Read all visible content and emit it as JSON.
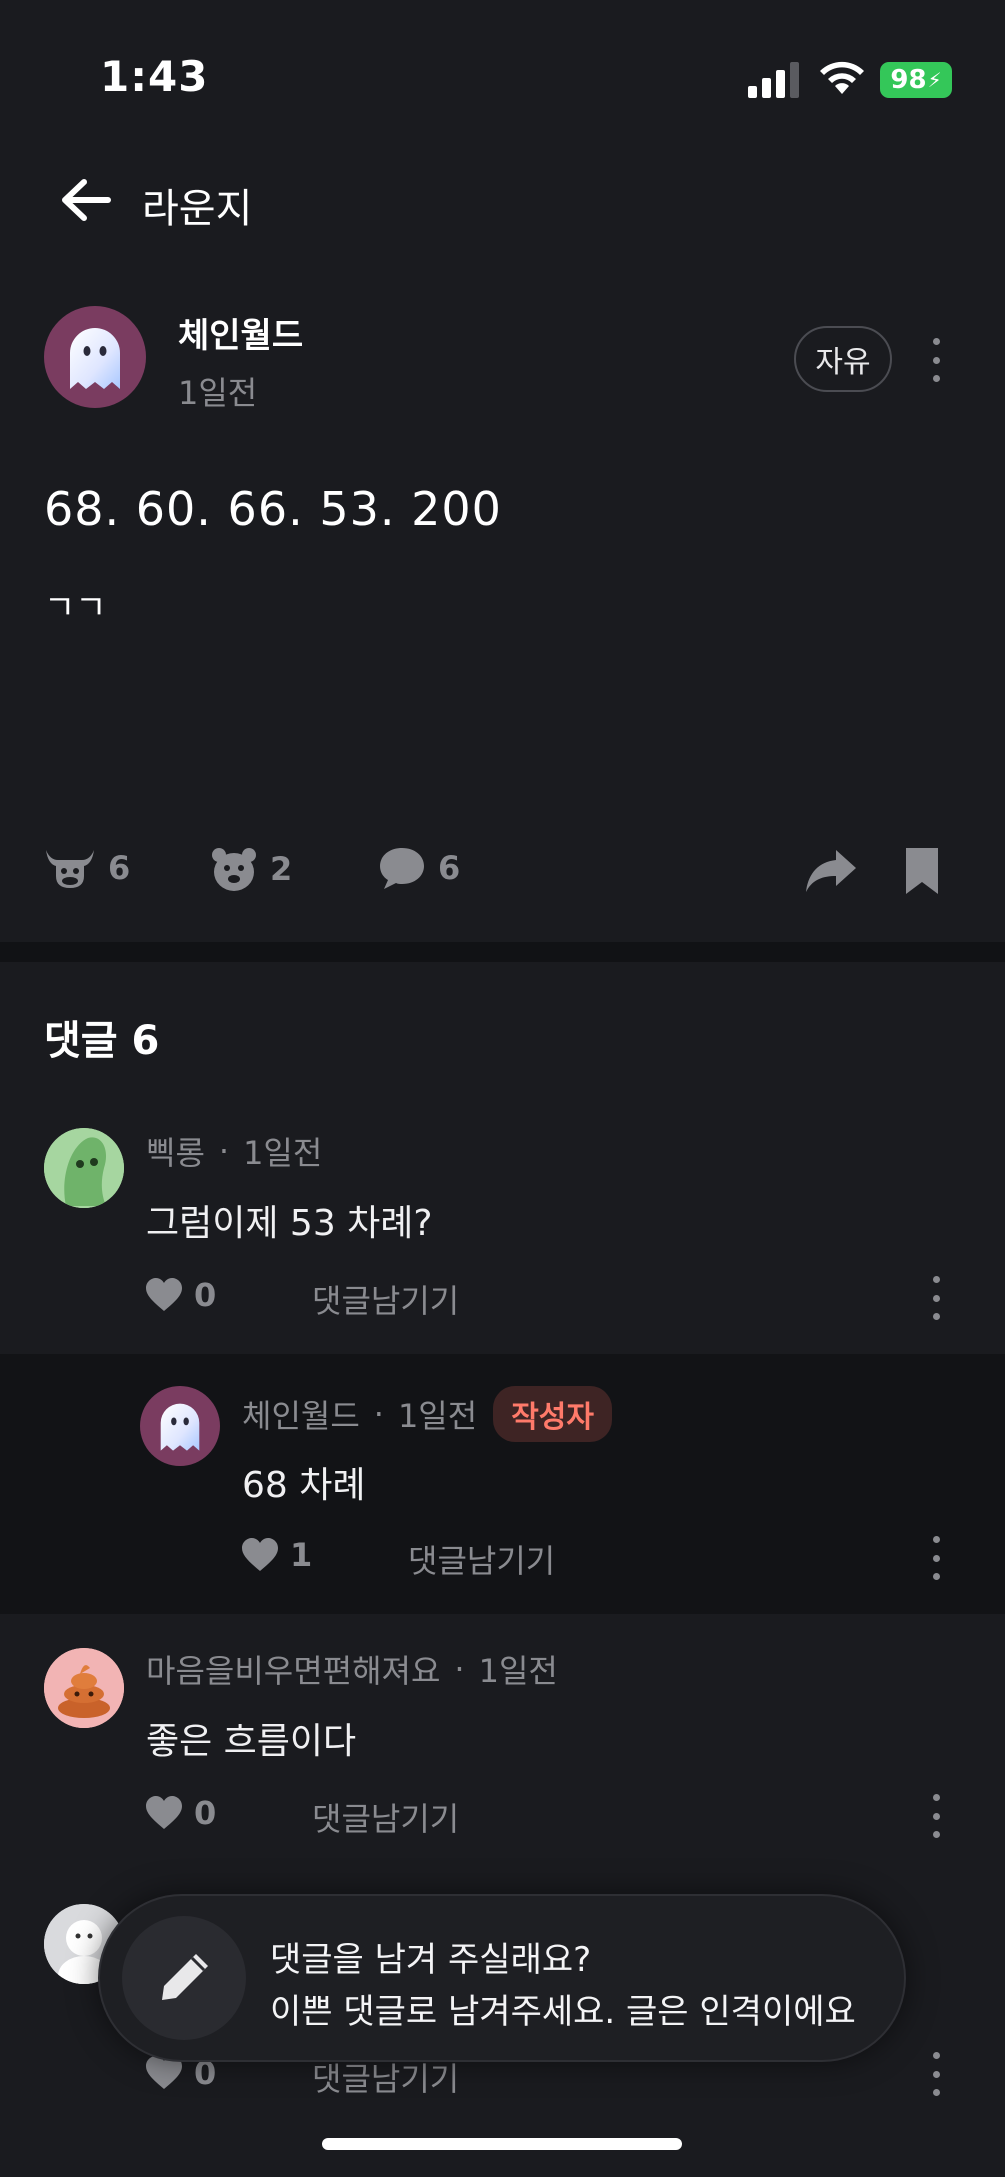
{
  "status_bar": {
    "time": "1:43",
    "battery": "98"
  },
  "header": {
    "title": "라운지"
  },
  "post": {
    "author": "체인월드",
    "time": "1일전",
    "tag": "자유",
    "title": "68. 60. 66. 53. 200",
    "body": "ㄱㄱ",
    "actions": {
      "bull_count": "6",
      "bear_count": "2",
      "comment_count": "6"
    }
  },
  "comments_section": {
    "title": "댓글 6"
  },
  "comments": [
    {
      "author": "삑롱",
      "time": "1일전",
      "text": "그럼이제 53 차례?",
      "likes": "0",
      "reply_label": "댓글남기기"
    },
    {
      "author": "체인월드",
      "time": "1일전",
      "badge": "작성자",
      "text": "68 차례",
      "likes": "1",
      "reply_label": "댓글남기기"
    },
    {
      "author": "마음을비우면편해져요",
      "time": "1일전",
      "text": "좋은 흐름이다",
      "likes": "0",
      "reply_label": "댓글남기기"
    },
    {
      "likes": "0",
      "reply_label": "댓글남기기"
    }
  ],
  "composer": {
    "line1": "댓글을 남겨 주실래요?",
    "line2": "이쁜 댓글로 남겨주세요. 글은 인격이에요"
  },
  "colors": {
    "background": "#1a1b1f",
    "badge_text": "#ff7a6a",
    "battery": "#34c759"
  }
}
